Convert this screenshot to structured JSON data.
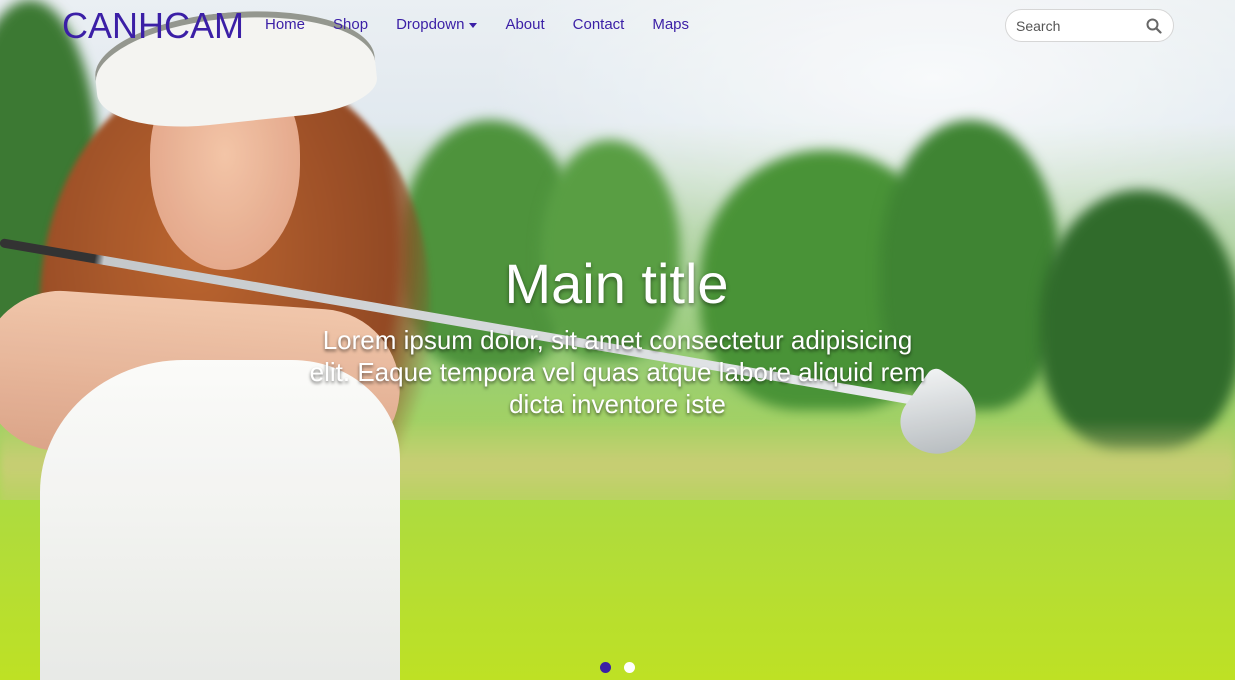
{
  "brand": {
    "name": "CANHCAM"
  },
  "nav": {
    "items": [
      {
        "label": "Home"
      },
      {
        "label": "Shop"
      },
      {
        "label": "Dropdown"
      },
      {
        "label": "About"
      },
      {
        "label": "Contact"
      },
      {
        "label": "Maps"
      }
    ]
  },
  "search": {
    "placeholder": "Search",
    "icon": "search-icon"
  },
  "hero": {
    "title": "Main title",
    "text": "Lorem ipsum dolor, sit amet consectetur adipisicing elit. Eaque tempora vel quas atque labore aliquid rem dicta inventore iste"
  },
  "carousel": {
    "active_index": 0,
    "count": 2
  },
  "colors": {
    "accent": "#3b1fa6",
    "caption_text": "#ffffff"
  }
}
